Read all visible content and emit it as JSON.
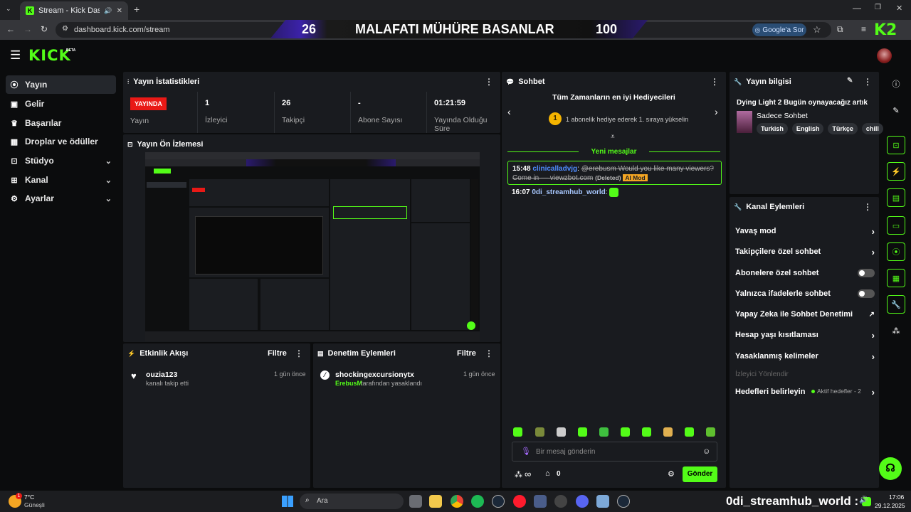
{
  "browser": {
    "tab_title": "Stream - Kick Dashboard",
    "url": "dashboard.kick.com/stream",
    "google_button": "Google'a Sor",
    "ext_label": "K2"
  },
  "banner": {
    "left_num": "26",
    "title": "MALAFATI MÜHÜRE BASANLAR",
    "right_num": "100"
  },
  "logo": "KICK",
  "logo_beta": "BETA",
  "sidebar": {
    "items": [
      {
        "label": "Yayın",
        "icon": "broadcast-icon"
      },
      {
        "label": "Gelir",
        "icon": "money-icon"
      },
      {
        "label": "Başarılar",
        "icon": "trophy-icon"
      },
      {
        "label": "Droplar ve ödüller",
        "icon": "drops-icon"
      },
      {
        "label": "Stüdyo",
        "icon": "studio-icon"
      },
      {
        "label": "Kanal",
        "icon": "channel-icon"
      },
      {
        "label": "Ayarlar",
        "icon": "gear-icon"
      }
    ]
  },
  "stats": {
    "title": "Yayın İstatistikleri",
    "live_badge": "YAYINDA",
    "live_label": "Yayın",
    "items": [
      {
        "value": "1",
        "label": "İzleyici"
      },
      {
        "value": "26",
        "label": "Takipçi"
      },
      {
        "value": "-",
        "label": "Abone Sayısı"
      },
      {
        "value": "01:21:59",
        "label": "Yayında Olduğu Süre"
      }
    ]
  },
  "preview": {
    "title": "Yayın Ön İzlemesi"
  },
  "activity": {
    "title": "Etkinlik Akışı",
    "filter": "Filtre",
    "entry": {
      "user": "ouzia123",
      "desc": "kanalı takip etti",
      "time": "1 gün önce"
    }
  },
  "moderation": {
    "title": "Denetim Eylemleri",
    "filter": "Filtre",
    "entry": {
      "user": "shockingexcursionytx",
      "by": "ErebusM",
      "desc": "tarafından yasaklandı",
      "time": "1 gün önce"
    }
  },
  "chat": {
    "title": "Sohbet",
    "gifters_title": "Tüm Zamanların en iyi Hediyecileri",
    "gifters_text": "1 abonelik hediye ederek 1. sıraya yükselin",
    "rank": "1",
    "new_messages": "Yeni mesajlar",
    "msg1": {
      "time": "15:48",
      "user": "clinicalladvjg",
      "text": "@erebusm Would you like many viewers? Come in — viewzbot.com",
      "deleted": "(Deleted)",
      "mod": "AI Mod"
    },
    "msg2": {
      "time": "16:07",
      "user": "0di_streamhub_world",
      "sep": ":"
    },
    "input_placeholder": "Bir mesaj gönderin",
    "points": "∞",
    "store_count": "0",
    "send": "Gönder"
  },
  "info": {
    "title": "Yayın bilgisi",
    "stream_title": "Dying Light 2 Bugün oynayacağız artık",
    "category": "Sadece Sohbet",
    "tags": [
      "Turkish",
      "English",
      "Türkçe",
      "chill"
    ]
  },
  "channel_actions": {
    "title": "Kanal Eylemleri",
    "rows": [
      {
        "label": "Yavaş mod",
        "kind": "arrow"
      },
      {
        "label": "Takipçilere özel sohbet",
        "kind": "arrow"
      },
      {
        "label": "Abonelere özel sohbet",
        "kind": "toggle"
      },
      {
        "label": "Yalnızca ifadelerle sohbet",
        "kind": "toggle"
      },
      {
        "label": "Yapay Zeka ile Sohbet Denetimi",
        "kind": "external"
      },
      {
        "label": "Hesap yaşı kısıtlaması",
        "kind": "arrow"
      },
      {
        "label": "Yasaklanmış kelimeler",
        "kind": "arrow"
      }
    ],
    "disabled": "İzleyici Yönlendir",
    "goals": "Hedefleri belirleyin",
    "goals_status": "Aktif hedefler - 2"
  },
  "taskbar": {
    "weather_temp": "7°C",
    "weather_desc": "Güneşli",
    "weather_badge": "1",
    "search": "Ara",
    "overlay_user": "0di_streamhub_world",
    "overlay_sep": ":",
    "time": "17:06",
    "date": "29.12.2025"
  },
  "colors": {
    "accent": "#53fc18",
    "live": "#e91916",
    "panel": "#191b1f"
  }
}
